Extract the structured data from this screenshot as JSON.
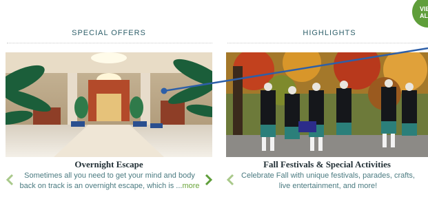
{
  "view_all_badge": {
    "text": "VIEW ALL"
  },
  "sections": {
    "offers": {
      "title": "SPECIAL OFFERS",
      "card": {
        "heading": "Overnight Escape",
        "description": "Sometimes all you need to get your mind and body back on track is an overnight escape, which is ...",
        "more_label": "more"
      }
    },
    "highlights": {
      "title": "HIGHLIGHTS",
      "card": {
        "heading": "Fall Festivals & Special Activities",
        "description": "Celebrate Fall with unique festivals, parades, crafts, live entertainment, and more!"
      }
    }
  },
  "icons": {
    "prev": "chevron-left-icon",
    "next": "chevron-right-icon"
  },
  "colors": {
    "accent_green": "#5f9e3a",
    "title_teal": "#2e5f6a",
    "desc_teal": "#4a7a80"
  }
}
